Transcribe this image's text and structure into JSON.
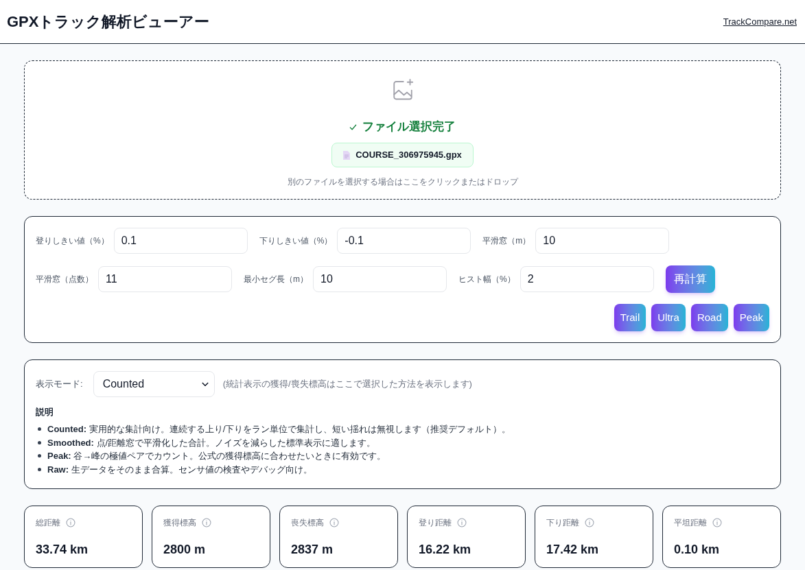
{
  "header": {
    "title": "GPXトラック解析ビューアー",
    "link": "TrackCompare.net"
  },
  "upload": {
    "status": "ファイル選択完了",
    "file_name": "COURSE_306975945.gpx",
    "hint": "別のファイルを選択する場合はここをクリックまたはドロップ"
  },
  "parameters": {
    "fields": [
      {
        "label": "登りしきい値（%）",
        "value": "0.1"
      },
      {
        "label": "下りしきい値（%）",
        "value": "-0.1"
      },
      {
        "label": "平滑窓（m）",
        "value": "10"
      },
      {
        "label": "平滑窓（点数）",
        "value": "11"
      },
      {
        "label": "最小セグ長（m）",
        "value": "10"
      },
      {
        "label": "ヒスト幅（%）",
        "value": "2"
      }
    ],
    "recalculate_button": "再計算",
    "presets": [
      "Trail",
      "Ultra",
      "Road",
      "Peak"
    ]
  },
  "display_mode": {
    "label": "表示モード:",
    "select": {
      "value": "Counted"
    },
    "note": "(統計表示の獲得/喪失標高はここで選択した方法を表示します)",
    "heading": "説明",
    "items": [
      "**Counted:** 実用的な集計向け。連続する上り/下りをラン単位で集計し、短い揺れは無視します（推奨デフォルト）。",
      "**Smoothed:** 点/距離窓で平滑化した合計。ノイズを減らした標準表示に適します。",
      "**Peak:** 谷→峰の極値ペアでカウント。公式の獲得標高に合わせたいときに有効です。",
      "**Raw:** 生データをそのまま合算。センサ値の検査やデバッグ向け。"
    ]
  },
  "stats": [
    {
      "label": "総距離",
      "value": "33.74 km"
    },
    {
      "label": "獲得標高",
      "value": "2800 m"
    },
    {
      "label": "喪失標高",
      "value": "2837 m"
    },
    {
      "label": "登り距離",
      "value": "16.22 km"
    },
    {
      "label": "下り距離",
      "value": "17.42 km"
    },
    {
      "label": "平坦距離",
      "value": "0.10 km"
    }
  ]
}
